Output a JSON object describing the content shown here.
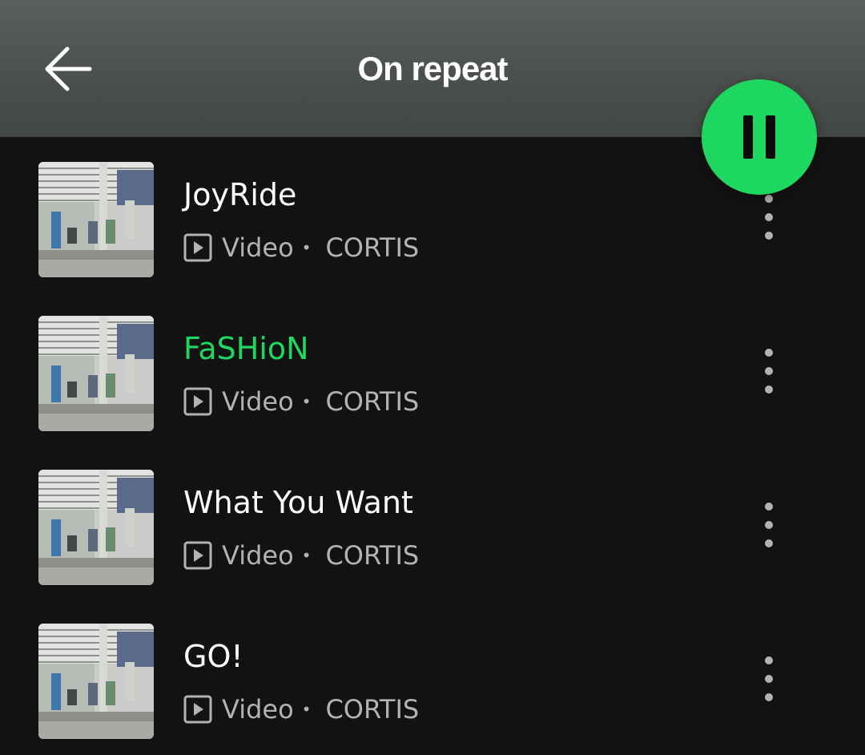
{
  "header": {
    "title": "On repeat",
    "back_icon": "arrow-left-icon"
  },
  "player": {
    "pause_icon": "pause-icon",
    "accent": "#1ed760"
  },
  "tracks": [
    {
      "title": "JoyRide",
      "type": "Video",
      "separator": "•",
      "artist": "CORTIS",
      "active": false
    },
    {
      "title": "FaSHioN",
      "type": "Video",
      "separator": "•",
      "artist": "CORTIS",
      "active": true
    },
    {
      "title": "What You Want",
      "type": "Video",
      "separator": "•",
      "artist": "CORTIS",
      "active": false
    },
    {
      "title": "GO!",
      "type": "Video",
      "separator": "•",
      "artist": "CORTIS",
      "active": false
    }
  ],
  "colors": {
    "background": "#121212",
    "header": "#4a4f4b",
    "secondary_text": "#b3b3b3"
  }
}
